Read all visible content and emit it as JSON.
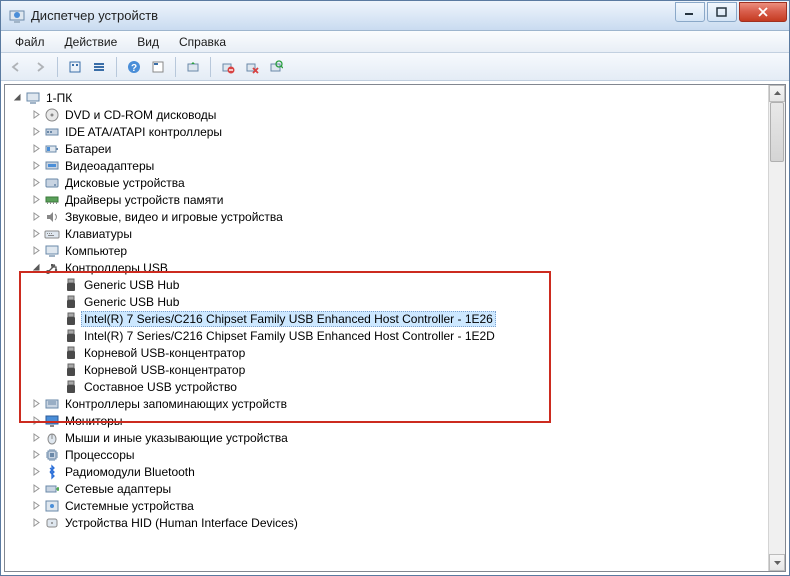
{
  "window": {
    "title": "Диспетчер устройств"
  },
  "menu": {
    "file": "Файл",
    "action": "Действие",
    "view": "Вид",
    "help": "Справка"
  },
  "tree": {
    "root": "1-ПК",
    "cat_dvd": "DVD и CD-ROM дисководы",
    "cat_ide": "IDE ATA/ATAPI контроллеры",
    "cat_bat": "Батареи",
    "cat_vid": "Видеоадаптеры",
    "cat_disk": "Дисковые устройства",
    "cat_memdrv": "Драйверы устройств памяти",
    "cat_sound": "Звуковые, видео и игровые устройства",
    "cat_kb": "Клавиатуры",
    "cat_comp": "Компьютер",
    "cat_usb": "Контроллеры USB",
    "usb_items": [
      "Generic USB Hub",
      "Generic USB Hub",
      "Intel(R) 7 Series/C216 Chipset Family USB Enhanced Host Controller - 1E26",
      "Intel(R) 7 Series/C216 Chipset Family USB Enhanced Host Controller - 1E2D",
      "Корневой USB-концентратор",
      "Корневой USB-концентратор",
      "Составное USB устройство"
    ],
    "usb_selected_index": 2,
    "cat_storage": "Контроллеры запоминающих устройств",
    "cat_mon": "Мониторы",
    "cat_mouse": "Мыши и иные указывающие устройства",
    "cat_cpu": "Процессоры",
    "cat_bt": "Радиомодули Bluetooth",
    "cat_net": "Сетевые адаптеры",
    "cat_sys": "Системные устройства",
    "cat_hid": "Устройства HID (Human Interface Devices)"
  }
}
